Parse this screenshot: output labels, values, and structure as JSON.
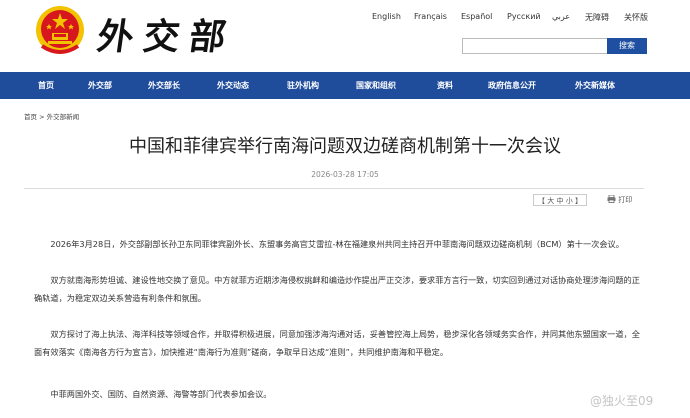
{
  "header": {
    "calligraphy": "外交部",
    "languages": [
      "English",
      "Français",
      "Español",
      "Русский",
      "عربي",
      "无障碍",
      "关怀版"
    ],
    "search": {
      "placeholder": "",
      "button": "搜索"
    }
  },
  "nav": {
    "items": [
      "首页",
      "外交部",
      "外交部长",
      "外交动态",
      "驻外机构",
      "国家和组织",
      "资料",
      "政府信息公开",
      "外交新媒体"
    ]
  },
  "breadcrumb": {
    "home": "首页",
    "sep": ">",
    "section": "外交部新闻"
  },
  "article": {
    "title": "中国和菲律宾举行南海问题双边磋商机制第十一次会议",
    "date": "2026-03-28 17:05",
    "font_size_controls": {
      "open": "【",
      "large": "大",
      "medium": "中",
      "small": "小",
      "close": "】"
    },
    "print_label": "打印",
    "paragraphs": [
      "2026年3月28日，外交部副部长孙卫东同菲律宾副外长、东盟事务高官艾雷拉-林在福建泉州共同主持召开中菲南海问题双边磋商机制（BCM）第十一次会议。",
      "双方就南海形势坦诚、建设性地交换了意见。中方就菲方近期涉海侵权挑衅和编造炒作提出严正交涉，要求菲方言行一致，切实回到通过对话协商处理涉海问题的正确轨道，为稳定双边关系营造有利条件和氛围。",
      "双方探讨了海上执法、海洋科技等领域合作，并取得积极进展，同意加强涉海沟通对话，妥善管控海上局势，稳步深化各领域务实合作，并同其他东盟国家一道，全面有效落实《南海各方行为宣言》，加快推进“南海行为准则”磋商，争取早日达成“准则”，共同维护南海和平稳定。",
      "中菲两国外交、国防、自然资源、海警等部门代表参加会议。"
    ]
  },
  "watermark": "@独火至09",
  "colors": {
    "nav": "#1f4d9c",
    "button": "#1e4fa0",
    "emblem_red": "#d6171e",
    "emblem_gold": "#f3c200"
  },
  "icons": {
    "emblem": "national-emblem-icon",
    "print": "printer-icon",
    "search": "search-icon"
  }
}
